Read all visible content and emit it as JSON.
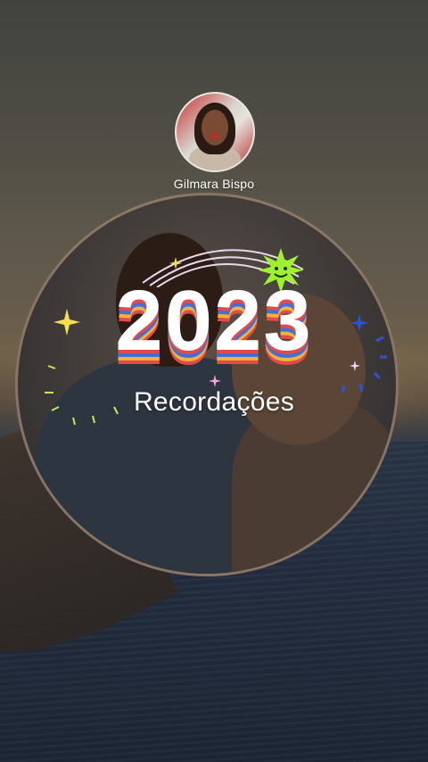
{
  "profile": {
    "name": "Gilmara Bispo"
  },
  "memories": {
    "year": "2023",
    "title": "Recordações"
  },
  "colors": {
    "stripe_red": "#e34b4b",
    "stripe_blue": "#3f6fd8",
    "stripe_yellow": "#f0b23a",
    "sun_green": "#9ef22d"
  },
  "icons": {
    "sun": "smiling-sun-icon",
    "rainbow": "rainbow-arc-icon",
    "sparkles": "sparkle-icon"
  }
}
